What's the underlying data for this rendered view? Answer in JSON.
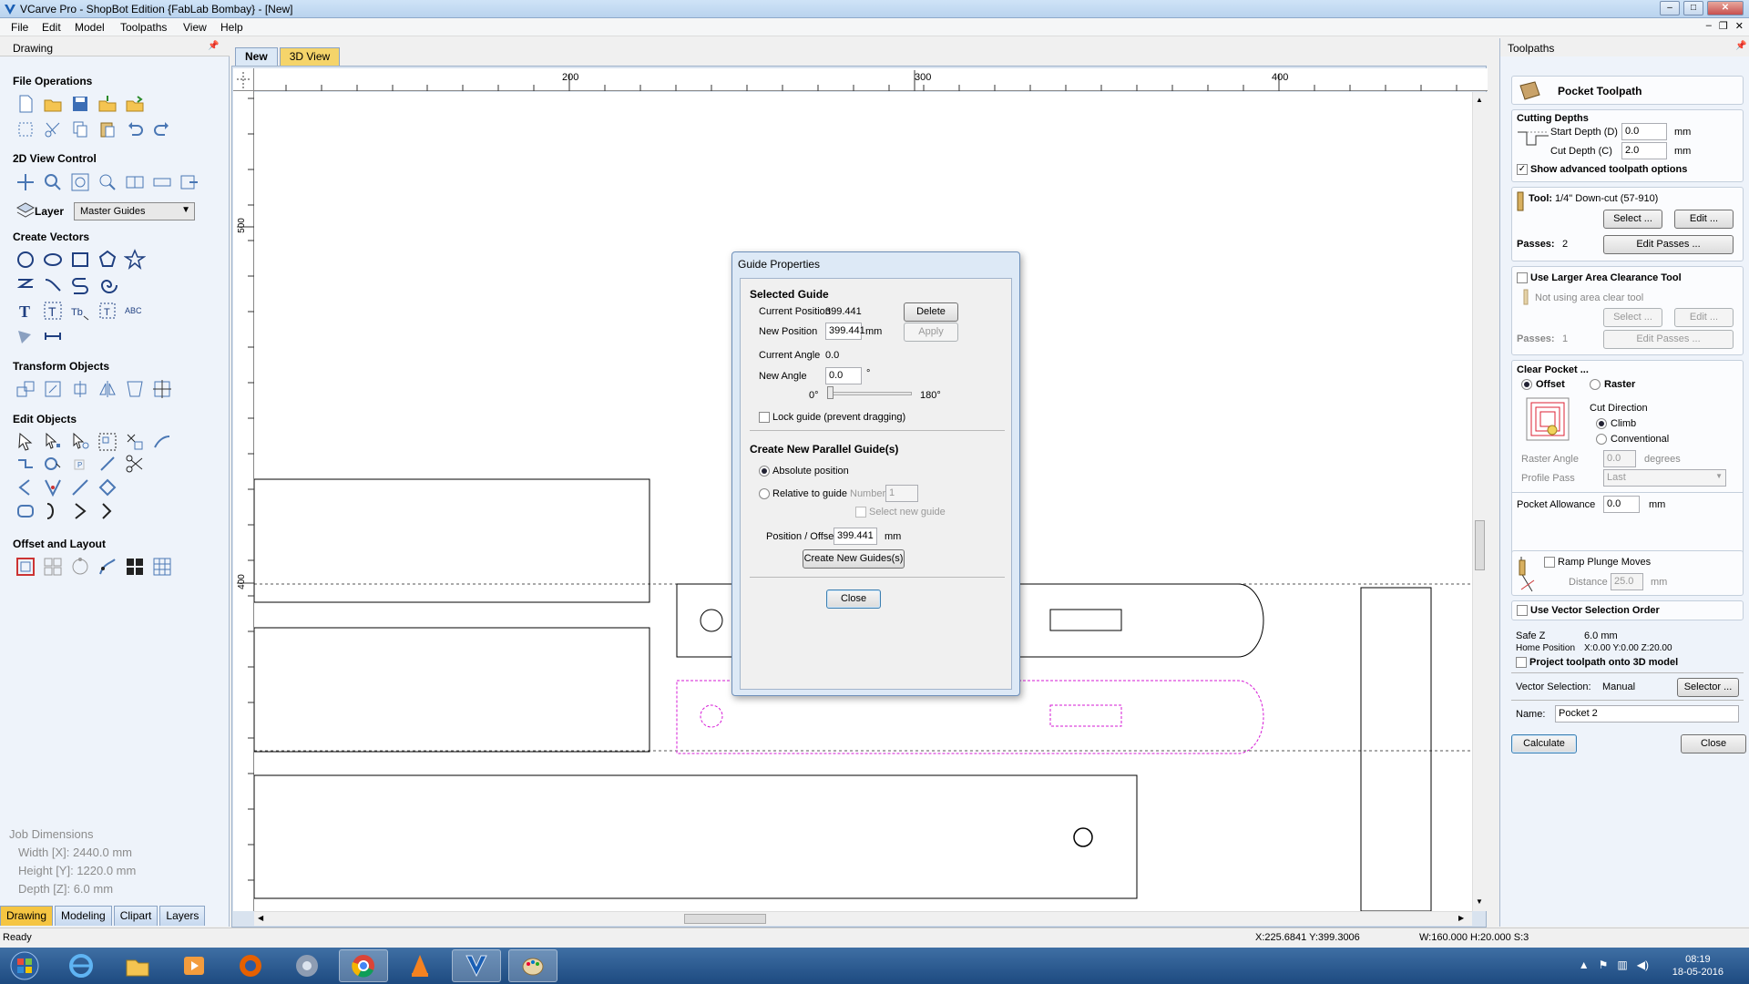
{
  "window": {
    "title": "VCarve Pro - ShopBot Edition {FabLab Bombay} - [New]"
  },
  "menu": [
    "File",
    "Edit",
    "Model",
    "Toolpaths",
    "View",
    "Help"
  ],
  "left_panel": {
    "header": "Drawing",
    "sections": {
      "file_operations": "File Operations",
      "view_control": "2D View Control",
      "create_vectors": "Create Vectors",
      "transform_objects": "Transform Objects",
      "edit_objects": "Edit Objects",
      "offset_layout": "Offset and Layout"
    },
    "layer_label": "Layer",
    "layer_value": "Master Guides",
    "job_dimensions": {
      "title": "Job Dimensions",
      "width": "Width  [X]: 2440.0 mm",
      "height": "Height [Y]: 1220.0 mm",
      "depth": "Depth  [Z]: 6.0 mm"
    },
    "tabs": [
      "Drawing",
      "Modeling",
      "Clipart",
      "Layers"
    ]
  },
  "doc_tabs": [
    "New",
    "3D View"
  ],
  "rulers": {
    "top_labels": [
      "200",
      "300",
      "400"
    ],
    "left_labels": [
      "500",
      "400"
    ]
  },
  "dialog": {
    "title": "Guide Properties",
    "selected_guide": "Selected Guide",
    "current_position_label": "Current Position",
    "current_position_value": "399.441",
    "delete_guide": "Delete Guide",
    "new_position_label": "New Position",
    "new_position_value": "399.441",
    "mm": "mm",
    "apply": "Apply",
    "current_angle_label": "Current Angle",
    "current_angle_value": "0.0",
    "new_angle_label": "New Angle",
    "new_angle_value": "0.0",
    "degree_symbol": "°",
    "slider_min": "0°",
    "slider_max": "180°",
    "lock_guide": "Lock guide (prevent dragging)",
    "create_parallel": "Create New Parallel Guide(s)",
    "absolute_position": "Absolute position",
    "relative_to_guide": "Relative to guide",
    "number_label": "Number:",
    "number_value": "1",
    "select_new_guide": "Select new guide",
    "position_offset_label": "Position / Offset",
    "position_offset_value": "399.441",
    "create_button": "Create New Guides(s)",
    "close_button": "Close"
  },
  "right_panel": {
    "header": "Toolpaths",
    "pocket_title": "Pocket Toolpath",
    "cutting_depths": "Cutting Depths",
    "start_depth_label": "Start Depth (D)",
    "start_depth_value": "0.0",
    "cut_depth_label": "Cut Depth (C)",
    "cut_depth_value": "2.0",
    "unit": "mm",
    "show_advanced": "Show advanced toolpath options",
    "tool_label": "Tool:",
    "tool_value": "1/4\" Down-cut (57-910)",
    "select_btn": "Select ...",
    "edit_btn": "Edit ...",
    "passes_label": "Passes:",
    "passes_value": "2",
    "edit_passes_btn": "Edit Passes ...",
    "larger_area": "Use Larger Area Clearance Tool",
    "not_using": "Not using area clear tool",
    "passes2_value": "1",
    "clear_pocket": "Clear Pocket ...",
    "offset": "Offset",
    "raster": "Raster",
    "cut_direction": "Cut Direction",
    "climb": "Climb",
    "conventional": "Conventional",
    "raster_angle_label": "Raster Angle",
    "raster_angle_value": "0.0",
    "degrees": "degrees",
    "profile_pass_label": "Profile Pass",
    "profile_pass_value": "Last",
    "pocket_allowance_label": "Pocket Allowance",
    "pocket_allowance_value": "0.0",
    "ramp_plunge": "Ramp Plunge Moves",
    "distance_label": "Distance",
    "distance_value": "25.0",
    "vector_order": "Use Vector Selection Order",
    "safe_z_label": "Safe Z",
    "safe_z_value": "6.0 mm",
    "home_label": "Home Position",
    "home_value": "X:0.00 Y:0.00 Z:20.00",
    "project": "Project toolpath onto 3D model",
    "vector_selection_label": "Vector Selection:",
    "vector_selection_value": "Manual",
    "selector_btn": "Selector ...",
    "name_label": "Name:",
    "name_value": "Pocket 2",
    "calculate": "Calculate",
    "close": "Close"
  },
  "status": {
    "ready": "Ready",
    "coords": "X:225.6841 Y:399.3006",
    "size": "W:160.000   H:20.000  S:3"
  },
  "taskbar": {
    "time": "08:19",
    "date": "18-05-2016"
  }
}
